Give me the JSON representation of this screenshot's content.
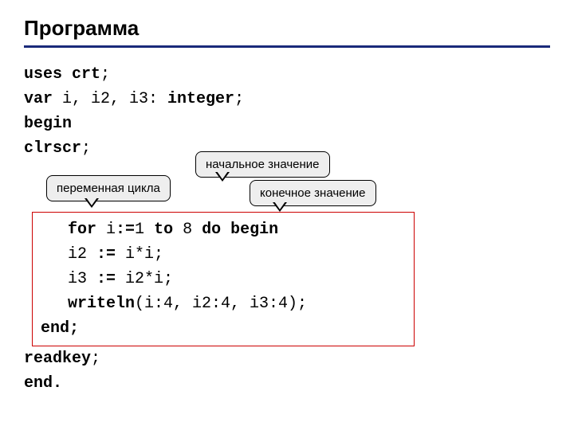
{
  "title": "Программа",
  "callouts": {
    "loop_var": "переменная цикла",
    "start_val": "начальное значение",
    "end_val": "конечное значение"
  },
  "code": {
    "l1a": "uses crt",
    "l1b": ";",
    "l2a": "var",
    "l2b": " i, i2, i3: ",
    "l2c": "integer",
    "l2d": ";",
    "l3": "begin",
    "l4a": "clrscr",
    "l4b": ";",
    "box1a": "for",
    "box1b": " i",
    "box1c": ":=",
    "box1d": "1 ",
    "box1e": "to",
    "box1f": " 8 ",
    "box1g": "do begin",
    "box2a": "i2 ",
    "box2b": ":=",
    "box2c": " i*i;",
    "box3a": "i3 ",
    "box3b": ":=",
    "box3c": " i2*i;",
    "box4a": "writeln",
    "box4b": "(i:4, i2:4, i3:4);",
    "box5": "end;",
    "l5a": "readkey",
    "l5b": ";",
    "l6": "end."
  }
}
